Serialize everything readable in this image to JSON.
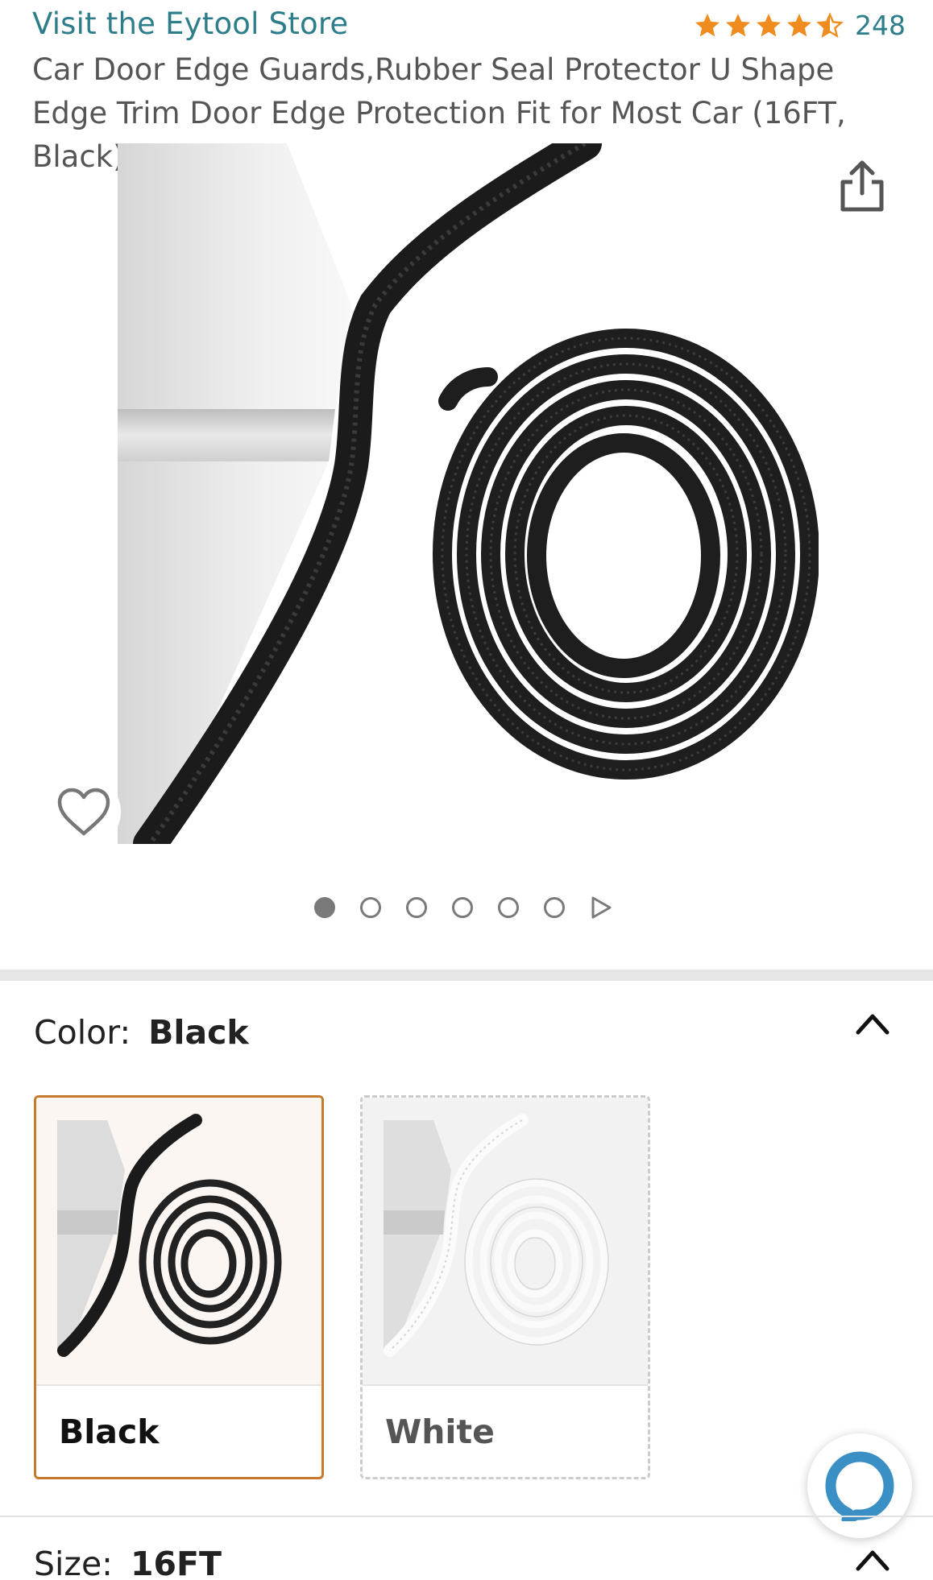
{
  "header": {
    "store_link": "Visit the Eytool Store",
    "rating_stars": 4.5,
    "rating_count": "248",
    "title": "Car Door Edge Guards,Rubber Seal Protector U Shape Edge Trim Door Edge Protection Fit for Most Car (16FT, Black)"
  },
  "colors": {
    "star": "#f08c1f",
    "link": "#2d7d8a",
    "selected_border": "#c67a2c"
  },
  "icons": {
    "share": "share-icon",
    "wishlist": "heart-icon",
    "next": "play-triangle-icon",
    "collapse": "chevron-up-icon",
    "chat": "chat-bubble-icon"
  },
  "gallery": {
    "image_count": 6,
    "active_index": 0
  },
  "color_selector": {
    "label": "Color:",
    "selected": "Black",
    "options": [
      {
        "label": "Black",
        "selected": true
      },
      {
        "label": "White",
        "selected": false
      }
    ]
  },
  "size_selector": {
    "label": "Size:",
    "selected": "16FT"
  }
}
